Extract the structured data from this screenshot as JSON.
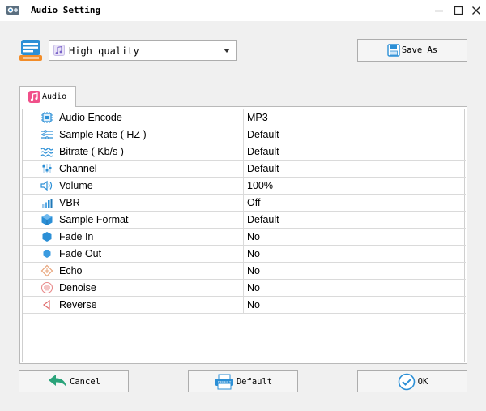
{
  "window": {
    "title": "Audio Setting",
    "minimize_icon": "minimize-icon",
    "maximize_icon": "maximize-icon",
    "close_icon": "close-icon"
  },
  "preset": {
    "icon": "preset-list-icon",
    "value": "High quality",
    "note_icon": "music-note-icon"
  },
  "toolbar": {
    "save_as_label": "Save As",
    "save_as_icon": "save-icon"
  },
  "tabs": [
    {
      "label": "Audio",
      "icon": "music-note-icon",
      "selected": true
    }
  ],
  "settings": [
    {
      "name": "Audio Encode",
      "value": "MP3",
      "icon": "chip-icon"
    },
    {
      "name": "Sample Rate ( HZ )",
      "value": "Default",
      "icon": "waveform-icon"
    },
    {
      "name": "Bitrate ( Kb/s )",
      "value": "Default",
      "icon": "waves-icon"
    },
    {
      "name": "Channel",
      "value": "Default",
      "icon": "channel-icon"
    },
    {
      "name": "Volume",
      "value": "100%",
      "icon": "speaker-icon"
    },
    {
      "name": "VBR",
      "value": "Off",
      "icon": "bar-chart-icon"
    },
    {
      "name": "Sample Format",
      "value": "Default",
      "icon": "cube-icon"
    },
    {
      "name": "Fade In",
      "value": "No",
      "icon": "fade-in-icon"
    },
    {
      "name": "Fade Out",
      "value": "No",
      "icon": "fade-out-icon"
    },
    {
      "name": "Echo",
      "value": "No",
      "icon": "echo-icon"
    },
    {
      "name": "Denoise",
      "value": "No",
      "icon": "denoise-icon"
    },
    {
      "name": "Reverse",
      "value": "No",
      "icon": "reverse-icon"
    }
  ],
  "footer": {
    "cancel_label": "Cancel",
    "default_label": "Default",
    "ok_label": "OK",
    "default_icon_text": "DEFAULT"
  },
  "colors": {
    "accent_blue": "#2b8fd6",
    "cancel_green": "#2aa37a",
    "tab_pink": "#f0508a"
  }
}
